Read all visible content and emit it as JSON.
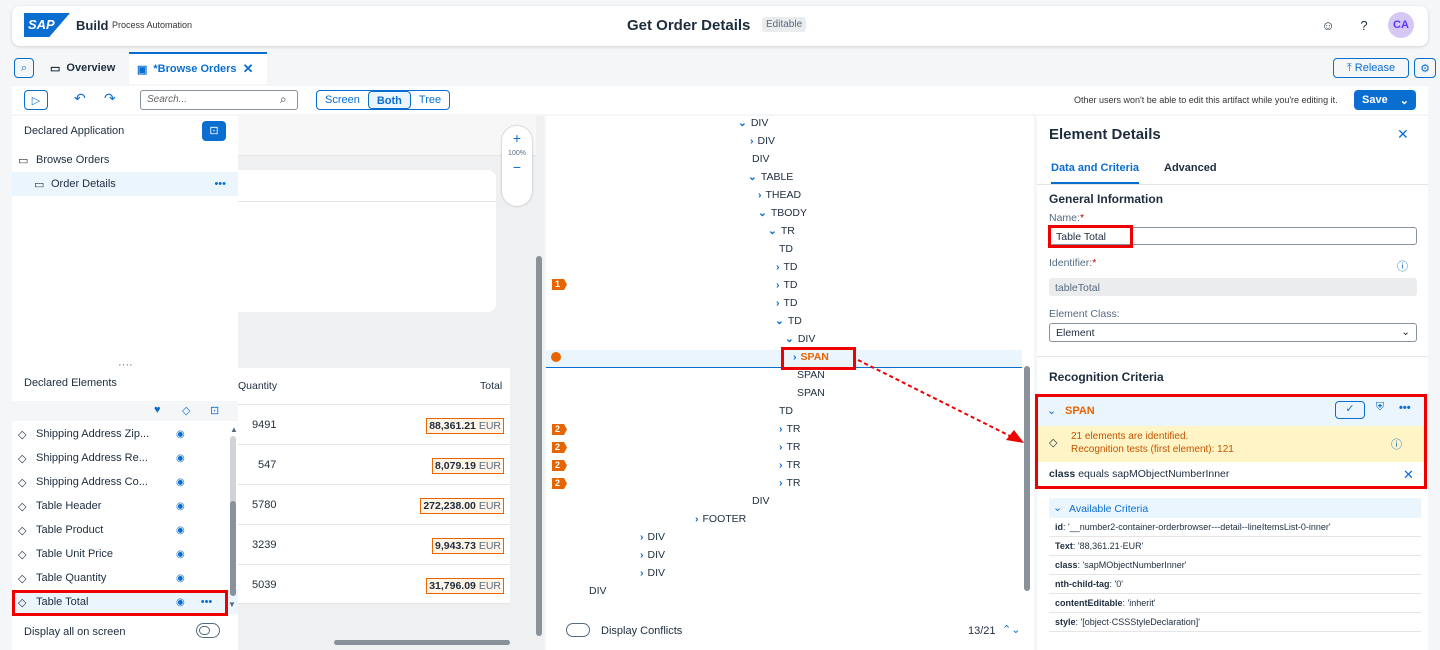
{
  "shell": {
    "logo": "SAP",
    "product": "Build",
    "subproduct": "Process Automation",
    "title": "Get Order Details",
    "badge": "Editable",
    "avatar": "CA"
  },
  "tabs": {
    "overview": "Overview",
    "browse": "*Browse Orders",
    "release": "Release"
  },
  "toolbar": {
    "search_placeholder": "Search...",
    "seg": [
      "Screen",
      "Both",
      "Tree"
    ],
    "notice": "Other users won't be able to edit this artifact while you're editing it.",
    "save": "Save"
  },
  "left": {
    "declared_app": "Declared Application",
    "screens": [
      "Browse Orders",
      "Order Details"
    ],
    "declared_elements": "Declared Elements",
    "elements": [
      "Shipping Address Zip...",
      "Shipping Address Re...",
      "Shipping Address Co...",
      "Table Header",
      "Table Product",
      "Table Unit Price",
      "Table Quantity",
      "Table Total"
    ],
    "display_all": "Display all on screen"
  },
  "preview": {
    "col_quantity": "Quantity",
    "col_total": "Total",
    "zoom": "100%",
    "rows": [
      {
        "qty": "9491",
        "amount": "88,361.21",
        "cur": "EUR"
      },
      {
        "qty": "547",
        "amount": "8,079.19",
        "cur": "EUR"
      },
      {
        "qty": "5780",
        "amount": "272,238.00",
        "cur": "EUR"
      },
      {
        "qty": "3239",
        "amount": "9,943.73",
        "cur": "EUR"
      },
      {
        "qty": "5039",
        "amount": "31,796.09",
        "cur": "EUR"
      }
    ]
  },
  "tree": {
    "nodes": [
      "DIV",
      "DIV",
      "DIV",
      "TABLE",
      "THEAD",
      "TBODY",
      "TR",
      "TD",
      "TD",
      "TD",
      "TD",
      "TD",
      "DIV",
      "SPAN",
      "SPAN",
      "SPAN",
      "TD",
      "TR",
      "TR",
      "TR",
      "TR",
      "DIV",
      "FOOTER",
      "DIV",
      "DIV",
      "DIV",
      "DIV"
    ],
    "badges": [
      "1",
      "2",
      "2",
      "2",
      "2"
    ],
    "display_conflicts": "Display Conflicts",
    "pager": "13/21"
  },
  "details": {
    "title": "Element Details",
    "tab_data": "Data and Criteria",
    "tab_adv": "Advanced",
    "general": "General Information",
    "name_label": "Name:",
    "name_value": "Table Total",
    "id_label": "Identifier:",
    "id_value": "tableTotal",
    "class_label": "Element Class:",
    "class_value": "Element",
    "recog": "Recognition Criteria",
    "span": "SPAN",
    "warn1": "21 elements are identified.",
    "warn2": "Recognition tests (first element): 121",
    "crit_attr": "class",
    "crit_op": "equals",
    "crit_val": "sapMObjectNumberInner",
    "avail": "Available Criteria",
    "avail_list": [
      {
        "k": "id",
        "v": "'__number2-container-orderbrowser---detail--lineItemsList-0-inner'"
      },
      {
        "k": "Text",
        "v": "'88,361.21·EUR'"
      },
      {
        "k": "class",
        "v": "'sapMObjectNumberInner'"
      },
      {
        "k": "nth-child-tag",
        "v": "'0'"
      },
      {
        "k": "contentEditable",
        "v": "'inherit'"
      },
      {
        "k": "style",
        "v": "'[object·CSSStyleDeclaration]'"
      }
    ]
  }
}
